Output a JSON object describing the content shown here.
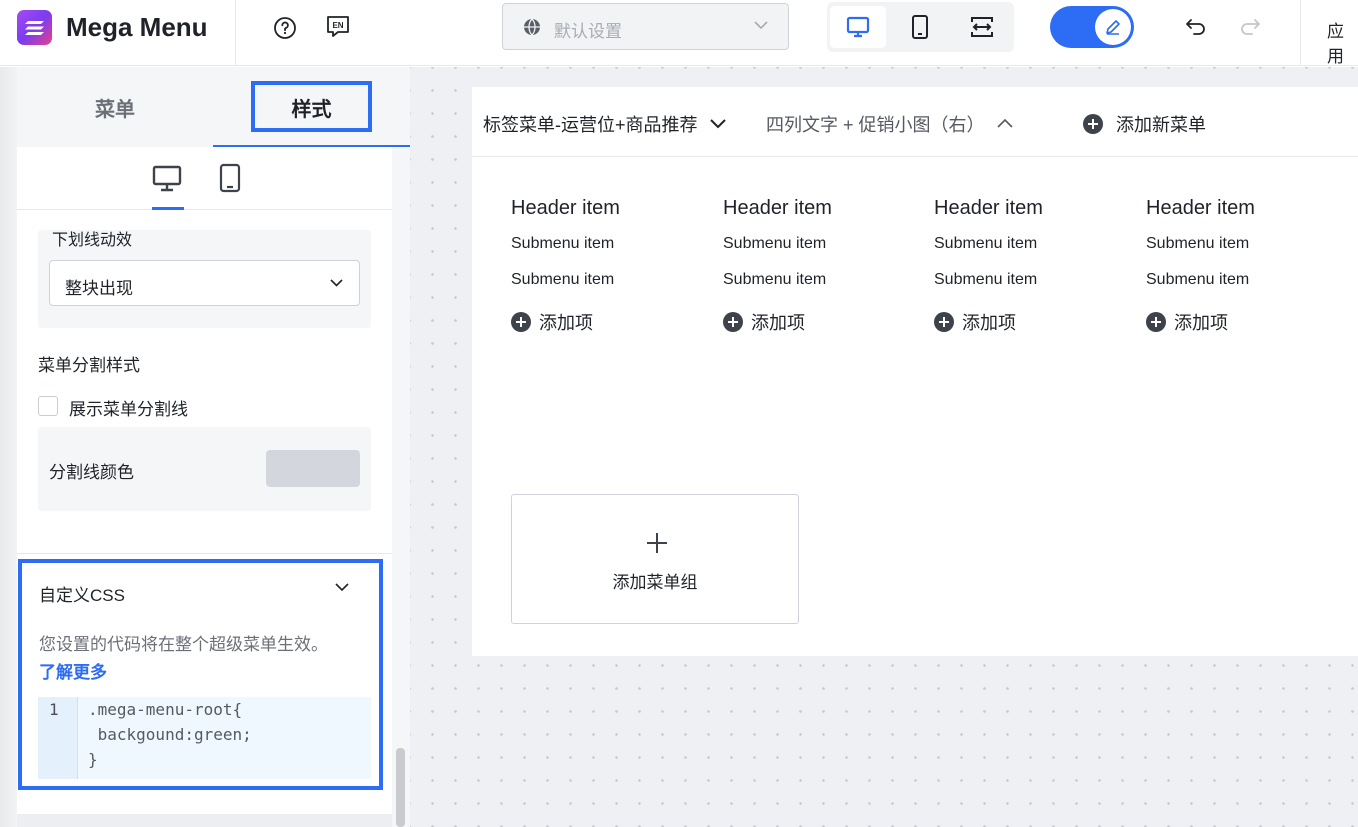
{
  "app": {
    "title": "Mega Menu"
  },
  "topbar": {
    "help_icon": "question-circle-icon",
    "lang_icon": "EN",
    "locale_select": "默认设置",
    "devices": [
      "desktop",
      "tablet",
      "responsive"
    ],
    "apply_label": "应用"
  },
  "left": {
    "tabs": [
      {
        "label": "菜单"
      },
      {
        "label": "样式"
      }
    ],
    "underline_anim": {
      "label": "下划线动效",
      "value": "整块出现"
    },
    "divider_section": {
      "title": "菜单分割样式",
      "show_divider_label": "展示菜单分割线",
      "show_divider_checked": false,
      "color_label": "分割线颜色",
      "color_value": "#d3d6dd"
    },
    "custom_css": {
      "title": "自定义CSS",
      "description": "您设置的代码将在整个超级菜单生效。",
      "learn_more": "了解更多",
      "line_number": "1",
      "code_lines": [
        ".mega-menu-root{",
        " backgound:green;",
        "}"
      ]
    }
  },
  "preview": {
    "menu_tabs": [
      {
        "label": "标签菜单-运营位+商品推荐"
      },
      {
        "label": "四列文字 + 促销小图（右）"
      },
      {
        "label": "添加新菜单"
      }
    ],
    "columns": [
      {
        "header": "Header item",
        "items": [
          "Submenu item",
          "Submenu item"
        ],
        "add": "添加项"
      },
      {
        "header": "Header item",
        "items": [
          "Submenu item",
          "Submenu item"
        ],
        "add": "添加项"
      },
      {
        "header": "Header item",
        "items": [
          "Submenu item",
          "Submenu item"
        ],
        "add": "添加项"
      },
      {
        "header": "Header item",
        "items": [
          "Submenu item",
          "Submenu item"
        ],
        "add": "添加项"
      }
    ],
    "add_group": "添加菜单组"
  },
  "colors": {
    "accent": "#2d6df5",
    "canvas": "#eef0f4"
  }
}
